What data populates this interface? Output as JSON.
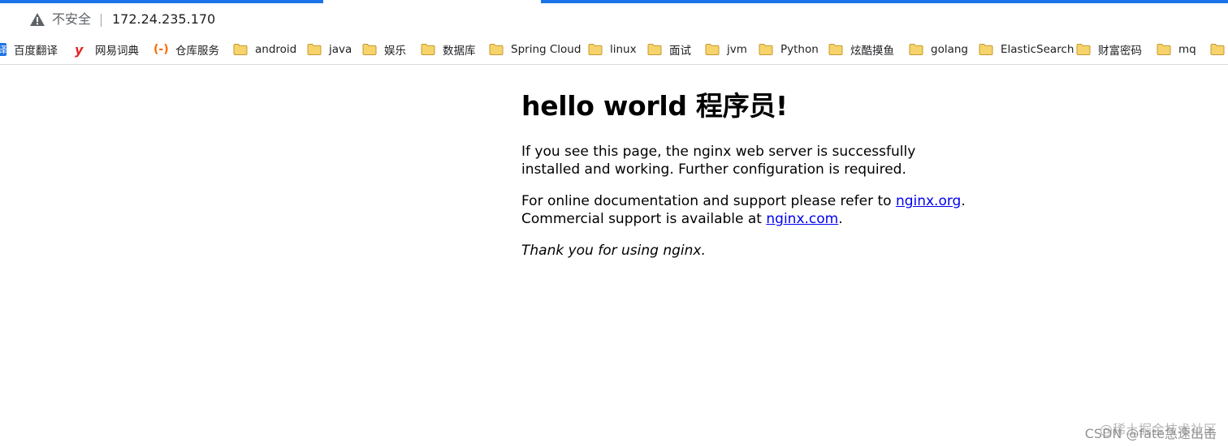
{
  "browser": {
    "security_label": "不安全",
    "url": "172.24.235.170",
    "colors": {
      "accent": "#1a73e8",
      "warning": "#5f6368"
    }
  },
  "bookmarks": [
    {
      "label": "百度翻译",
      "icon": "baidu-translate-icon"
    },
    {
      "label": "网易词典",
      "icon": "youdao-icon"
    },
    {
      "label": "仓库服务",
      "icon": "aliyun-icon"
    },
    {
      "label": "android",
      "icon": "folder-icon"
    },
    {
      "label": "java",
      "icon": "folder-icon"
    },
    {
      "label": "娱乐",
      "icon": "folder-icon"
    },
    {
      "label": "数据库",
      "icon": "folder-icon"
    },
    {
      "label": "Spring Cloud",
      "icon": "folder-icon"
    },
    {
      "label": "linux",
      "icon": "folder-icon"
    },
    {
      "label": "面试",
      "icon": "folder-icon"
    },
    {
      "label": "jvm",
      "icon": "folder-icon"
    },
    {
      "label": "Python",
      "icon": "folder-icon"
    },
    {
      "label": "炫酷摸鱼",
      "icon": "folder-icon"
    },
    {
      "label": "golang",
      "icon": "folder-icon"
    },
    {
      "label": "ElasticSearch",
      "icon": "folder-icon"
    },
    {
      "label": "财富密码",
      "icon": "folder-icon"
    },
    {
      "label": "mq",
      "icon": "folder-icon"
    }
  ],
  "page": {
    "heading": "hello world 程序员!",
    "para1": "If you see this page, the nginx web server is successfully installed and working. Further configuration is required.",
    "para2_prefix": "For online documentation and support please refer to ",
    "link_org": "nginx.org",
    "para2_mid": ".",
    "para2_line2": "Commercial support is available at ",
    "link_com": "nginx.com",
    "para2_end": ".",
    "thanks": "Thank you for using nginx."
  },
  "watermark": {
    "line1": "@稀土掘金技术社区",
    "line2": "CSDN @fate急速出击"
  }
}
